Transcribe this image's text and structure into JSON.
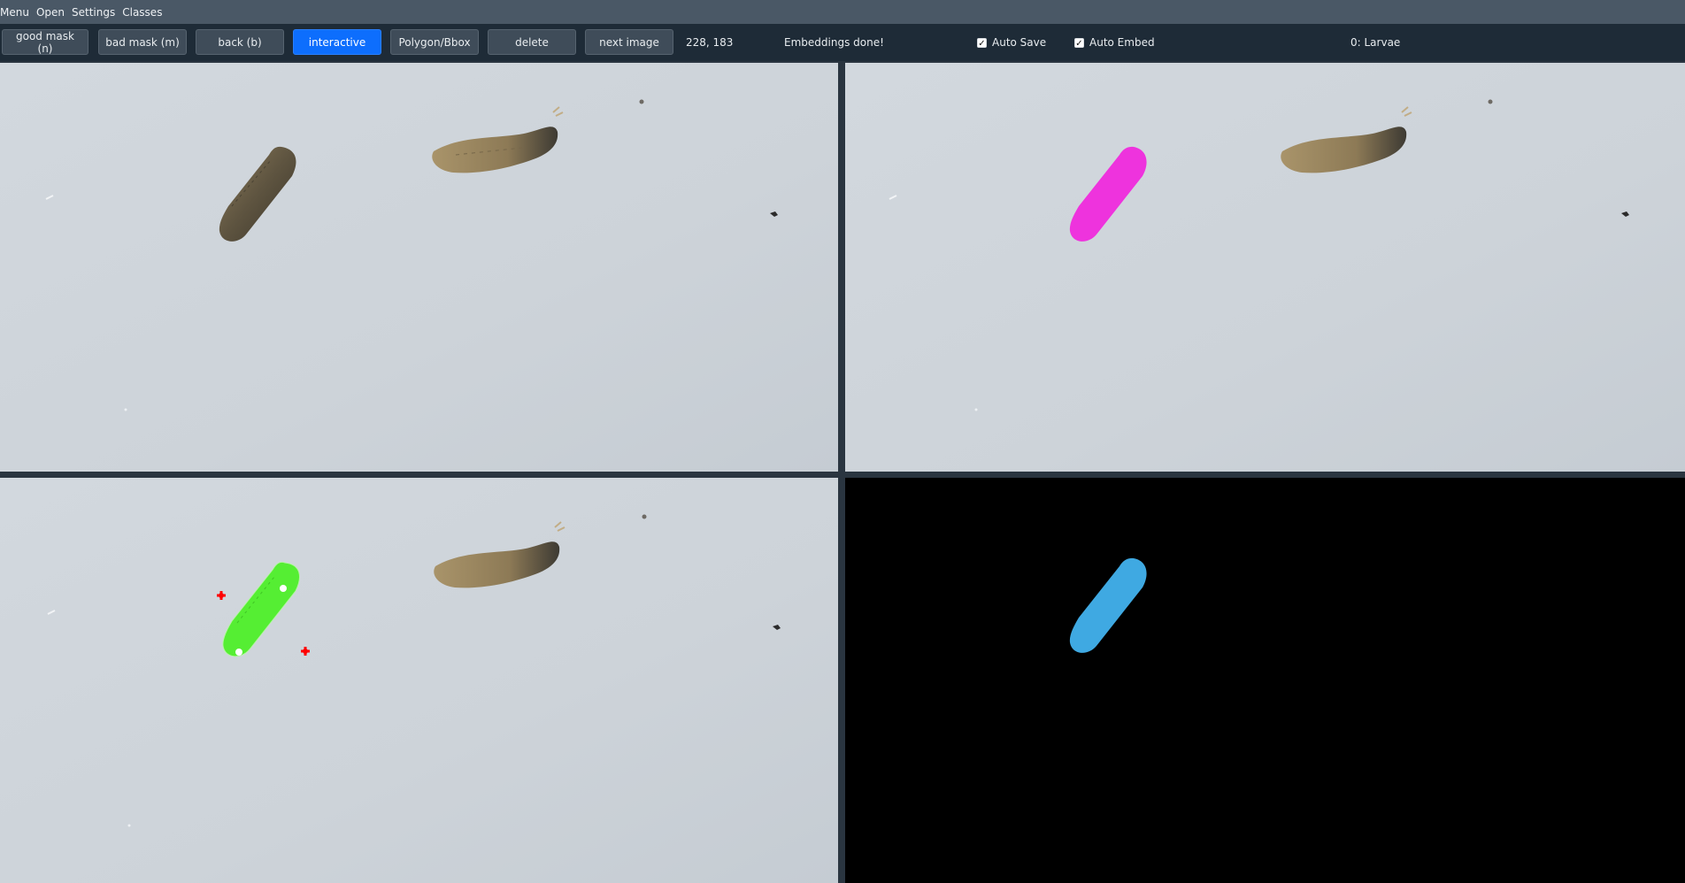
{
  "menubar": {
    "items": [
      "Menu",
      "Open",
      "Settings",
      "Classes"
    ]
  },
  "toolbar": {
    "good_mask": "good mask (n)",
    "bad_mask": "bad mask (m)",
    "back": "back (b)",
    "interactive": "interactive",
    "polygon_bbox": "Polygon/Bbox",
    "delete": "delete",
    "next_image": "next image",
    "cursor_coords": "228, 183",
    "status": "Embeddings done!",
    "auto_save_label": "Auto Save",
    "auto_save_checked": true,
    "auto_embed_label": "Auto Embed",
    "auto_embed_checked": true,
    "current_class": "0: Larvae"
  },
  "colors": {
    "active_button": "#0d6efd",
    "mask_magenta": "#ee33dd",
    "mask_green": "#55ee33",
    "mask_blue": "#3fa9e2",
    "negative_point": "#ff0000",
    "positive_point": "#ffffff"
  },
  "panes": {
    "top_left": "original-image",
    "top_right": "segmentation-overlay",
    "bottom_left": "interactive-prompt-view",
    "bottom_right": "mask-preview"
  }
}
